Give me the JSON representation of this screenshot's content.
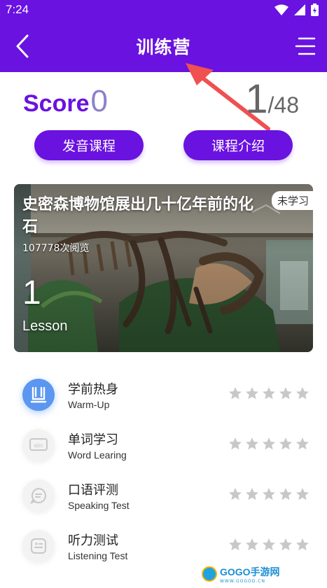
{
  "status_bar": {
    "time": "7:24"
  },
  "header": {
    "title": "训练营"
  },
  "score": {
    "label": "Score",
    "value": "0"
  },
  "progress": {
    "current": "1",
    "total": "/48"
  },
  "buttons": {
    "pronunciation": "发音课程",
    "intro": "课程介绍"
  },
  "lesson_card": {
    "title": "史密森博物馆展出几十亿年前的化石",
    "views": "107778次阅览",
    "badge": "未学习",
    "number": "1",
    "unit": "Lesson"
  },
  "tasks": [
    {
      "title": "学前热身",
      "subtitle": "Warm-Up",
      "icon": "warm-up-icon",
      "active": true,
      "stars": 0
    },
    {
      "title": "单词学习",
      "subtitle": "Word Learing",
      "icon": "abc-keyboard-icon",
      "active": false,
      "stars": 0
    },
    {
      "title": "口语评测",
      "subtitle": "Speaking Test",
      "icon": "speech-bubble-icon",
      "active": false,
      "stars": 0
    },
    {
      "title": "听力测试",
      "subtitle": "Listening Test",
      "icon": "listening-icon",
      "active": false,
      "stars": 0
    }
  ],
  "watermark": {
    "text": "GOGO手游网",
    "sub": "WWW.GOGOD.CN"
  },
  "colors": {
    "primary": "#6a12e0",
    "score_value": "#8a82cc",
    "active_icon": "#5b97f0",
    "star": "#c8c8c8",
    "arrow": "#f05050"
  }
}
